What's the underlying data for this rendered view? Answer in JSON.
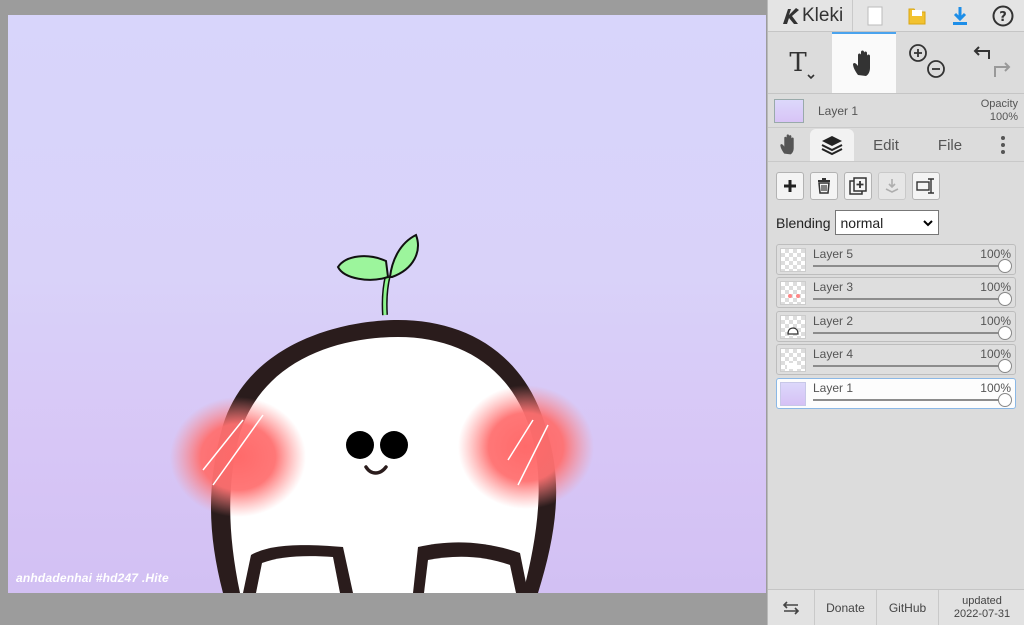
{
  "app": {
    "name": "Kleki"
  },
  "canvas": {
    "watermark": "anhdadenhai #hd247 .Hite"
  },
  "current_layer": {
    "name": "Layer 1",
    "opacity_label": "Opacity",
    "opacity_value": "100%"
  },
  "tabs": {
    "edit": "Edit",
    "file": "File"
  },
  "blending": {
    "label": "Blending",
    "value": "normal"
  },
  "layers": [
    {
      "name": "Layer 5",
      "opacity": "100%",
      "level": 1.0,
      "selected": false
    },
    {
      "name": "Layer 3",
      "opacity": "100%",
      "level": 1.0,
      "selected": false
    },
    {
      "name": "Layer 2",
      "opacity": "100%",
      "level": 1.0,
      "selected": false
    },
    {
      "name": "Layer 4",
      "opacity": "100%",
      "level": 1.0,
      "selected": false
    },
    {
      "name": "Layer 1",
      "opacity": "100%",
      "level": 1.0,
      "selected": true
    }
  ],
  "footer": {
    "donate": "Donate",
    "github": "GitHub",
    "updated_label": "updated",
    "updated_date": "2022-07-31"
  },
  "colors": {
    "accent": "#4aa3ee",
    "download": "#1d8ee8",
    "folder": "#f2c230"
  },
  "icons": [
    "kleki-logo-icon",
    "new-file-icon",
    "open-folder-icon",
    "download-icon",
    "help-icon",
    "text-tool-icon",
    "hand-tool-icon",
    "zoom-in-icon",
    "zoom-out-icon",
    "undo-icon",
    "redo-icon",
    "layers-icon",
    "more-icon",
    "add-layer-icon",
    "delete-layer-icon",
    "duplicate-layer-icon",
    "merge-layer-icon",
    "rename-layer-icon",
    "swap-icon"
  ]
}
